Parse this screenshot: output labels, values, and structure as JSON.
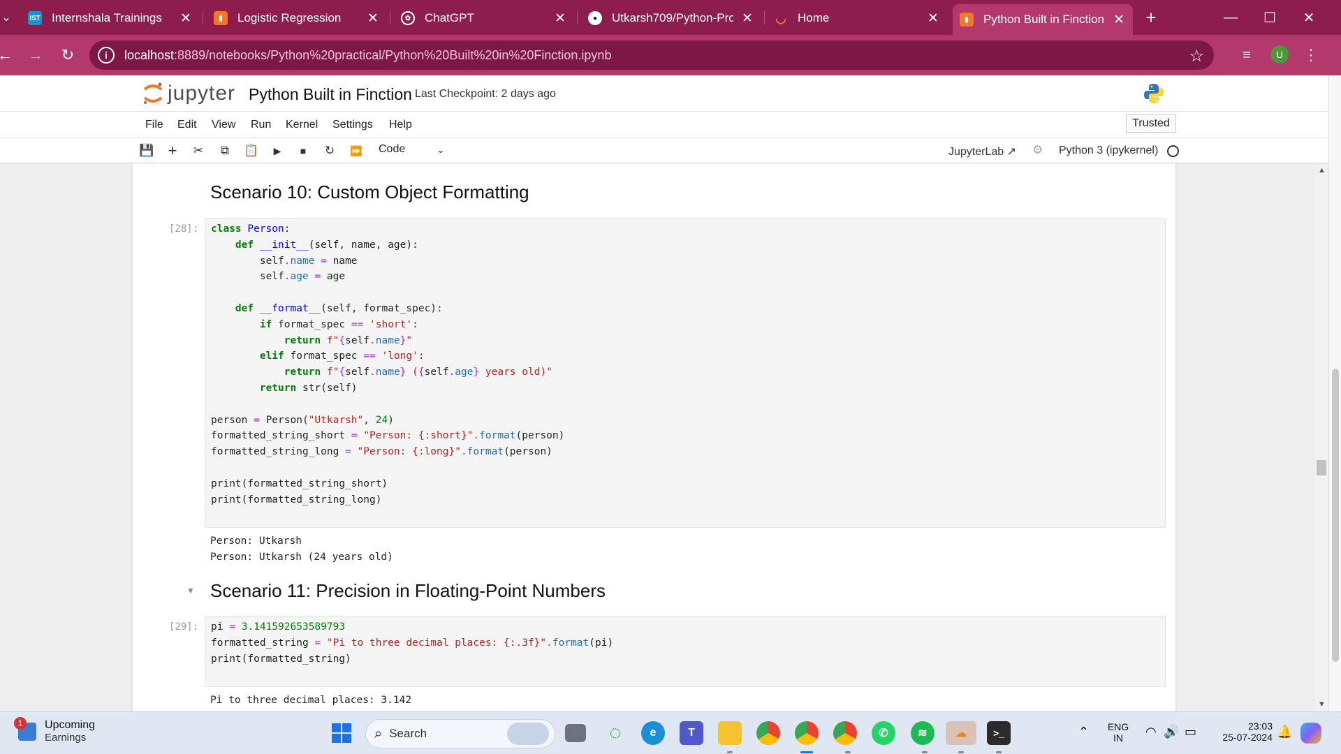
{
  "browser": {
    "tabs": [
      {
        "title": "Internshala Trainings",
        "icon": "internshala-icon",
        "color": "#1295d8"
      },
      {
        "title": "Logistic Regression",
        "icon": "jupyter-notebook-icon",
        "color": "#f37726"
      },
      {
        "title": "ChatGPT",
        "icon": "chatgpt-icon",
        "color": "#ffffff"
      },
      {
        "title": "Utkarsh709/Python-Progra",
        "icon": "github-icon",
        "color": "#ffffff"
      },
      {
        "title": "Home",
        "icon": "jupyter-home-icon",
        "color": "#f37726"
      },
      {
        "title": "Python Built in Finction",
        "icon": "jupyter-notebook-icon",
        "color": "#f37726",
        "active": true
      }
    ],
    "url_host": "localhost",
    "url_path": ":8889/notebooks/Python%20practical/Python%20Built%20in%20Finction.ipynb",
    "profile_initial": "U",
    "accent": "#b3396c"
  },
  "jupyter": {
    "logo_text": "jupyter",
    "notebook_title": "Python Built in Finction",
    "checkpoint": "Last Checkpoint: 2 days ago",
    "menus": [
      "File",
      "Edit",
      "View",
      "Run",
      "Kernel",
      "Settings",
      "Help"
    ],
    "trusted": "Trusted",
    "cell_type": "Code",
    "jupyterlab_link": "JupyterLab",
    "kernel_name": "Python 3 (ipykernel)"
  },
  "cells": {
    "heading10": "Scenario 10: Custom Object Formatting",
    "prompt28": "[28]:",
    "output28": [
      "Person: Utkarsh",
      "Person: Utkarsh (24 years old)"
    ],
    "heading11": "Scenario 11: Precision in Floating-Point Numbers",
    "prompt29": "[29]:",
    "output29": "Pi to three decimal places: 3.142"
  },
  "taskbar": {
    "widget_title": "Upcoming",
    "widget_subtitle": "Earnings",
    "widget_badge": "1",
    "search_label": "Search",
    "lang_1": "ENG",
    "lang_2": "IN",
    "time": "23:03",
    "date": "25-07-2024"
  }
}
